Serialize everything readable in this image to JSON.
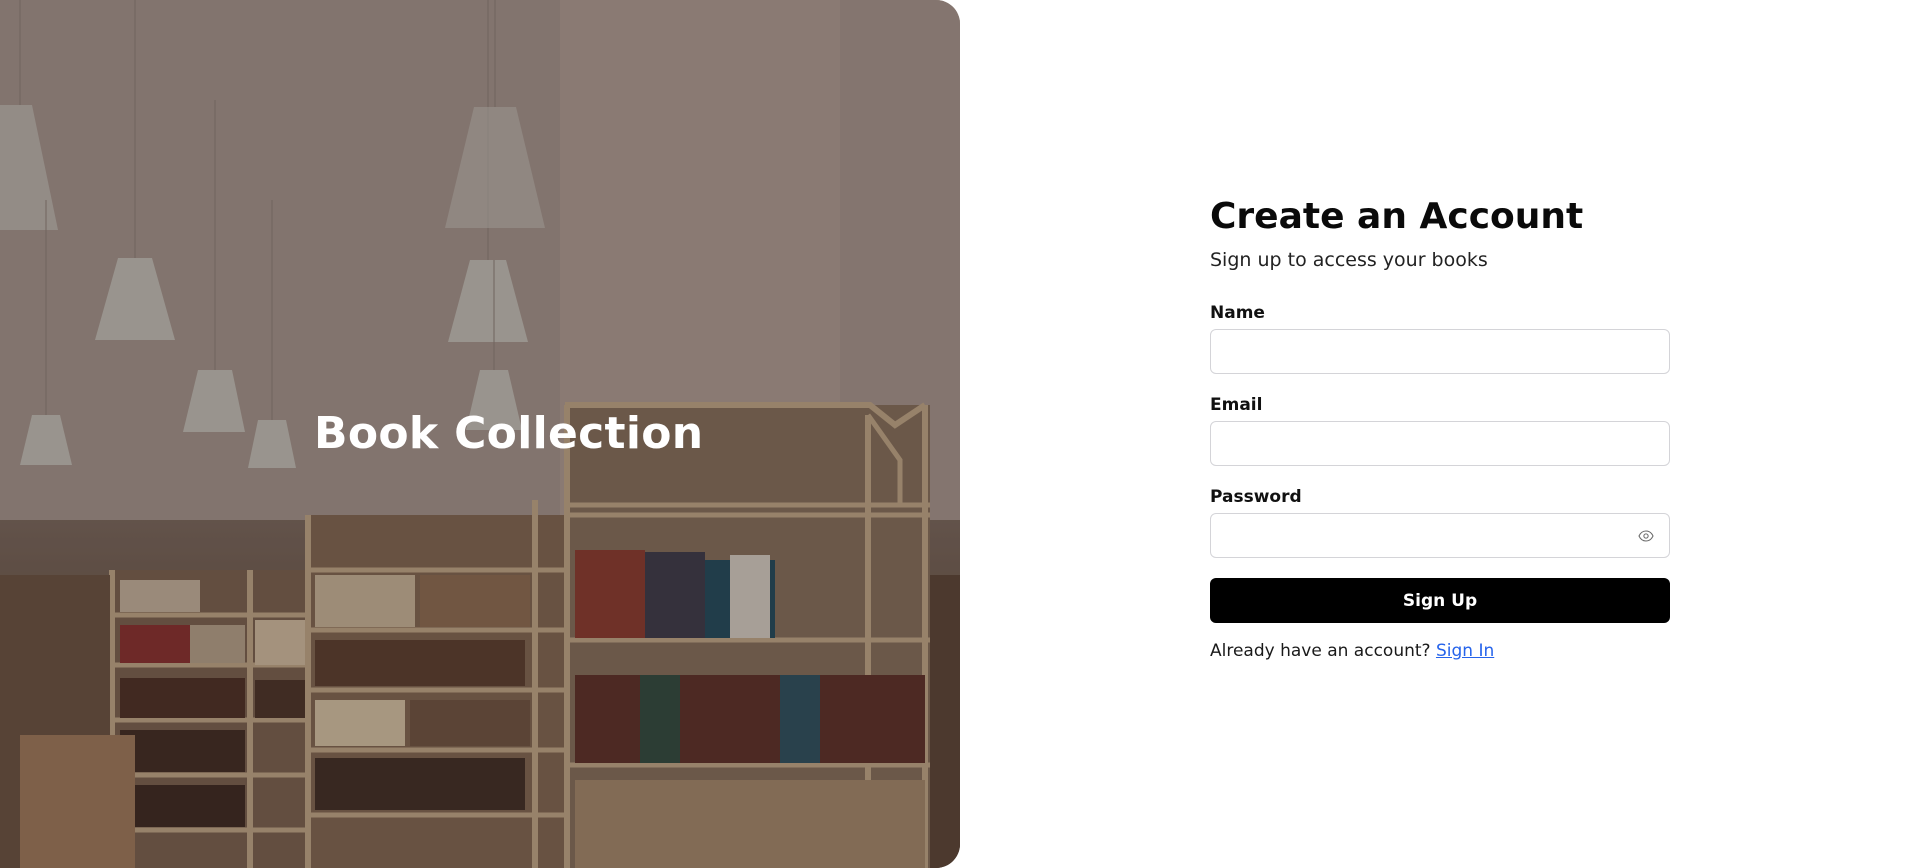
{
  "hero": {
    "title": "Book Collection"
  },
  "form": {
    "title": "Create an Account",
    "subtitle": "Sign up to access your books",
    "fields": {
      "name": {
        "label": "Name",
        "value": "",
        "placeholder": ""
      },
      "email": {
        "label": "Email",
        "value": "",
        "placeholder": ""
      },
      "password": {
        "label": "Password",
        "value": "",
        "placeholder": "",
        "toggle_icon": "eye-icon"
      }
    },
    "submit_label": "Sign Up",
    "signin_prompt": "Already have an account?",
    "signin_link": "Sign In"
  },
  "colors": {
    "primary_button": "#000000",
    "link": "#2563eb"
  }
}
